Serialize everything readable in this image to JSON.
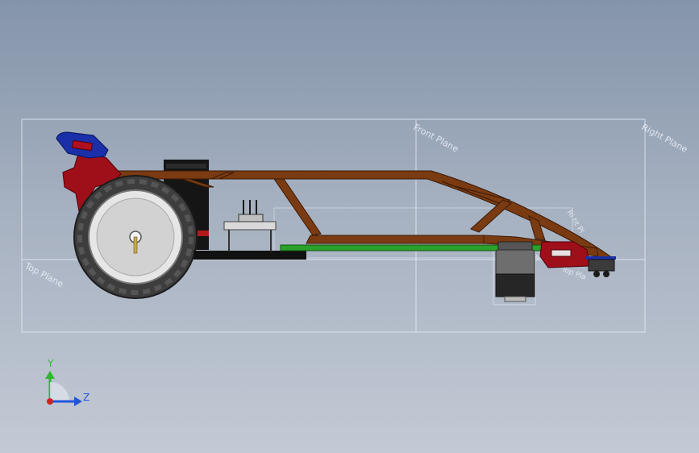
{
  "viewport": {
    "view_orientation": "side (Y up, Z right)",
    "background_top_color": "#8494aa",
    "background_bottom_color": "#c3cad5"
  },
  "reference_planes": {
    "front_plane": "Front Plane",
    "right_plane": "Right Plane",
    "top_plane": "Top Plane",
    "front_plane_small": "Front Pl",
    "right_plane_small": "Ri ht Pl",
    "top_plane_small": "Top Pla"
  },
  "triad": {
    "y_label": "Y",
    "z_label": "Z",
    "y_color": "#2eb82e",
    "z_color": "#2255dd",
    "origin_color": "#cc2222"
  },
  "model_colors": {
    "frame": "#7a3b12",
    "fender_red": "#9e0f1a",
    "fender_blue": "#1a2fa8",
    "wheel_tire": "#4a4a4a",
    "wheel_hub": "#c8c8c8",
    "pcb_green": "#2aa12a",
    "battery_black": "#1a1a1a",
    "motor_gray": "#6e6e6e"
  }
}
